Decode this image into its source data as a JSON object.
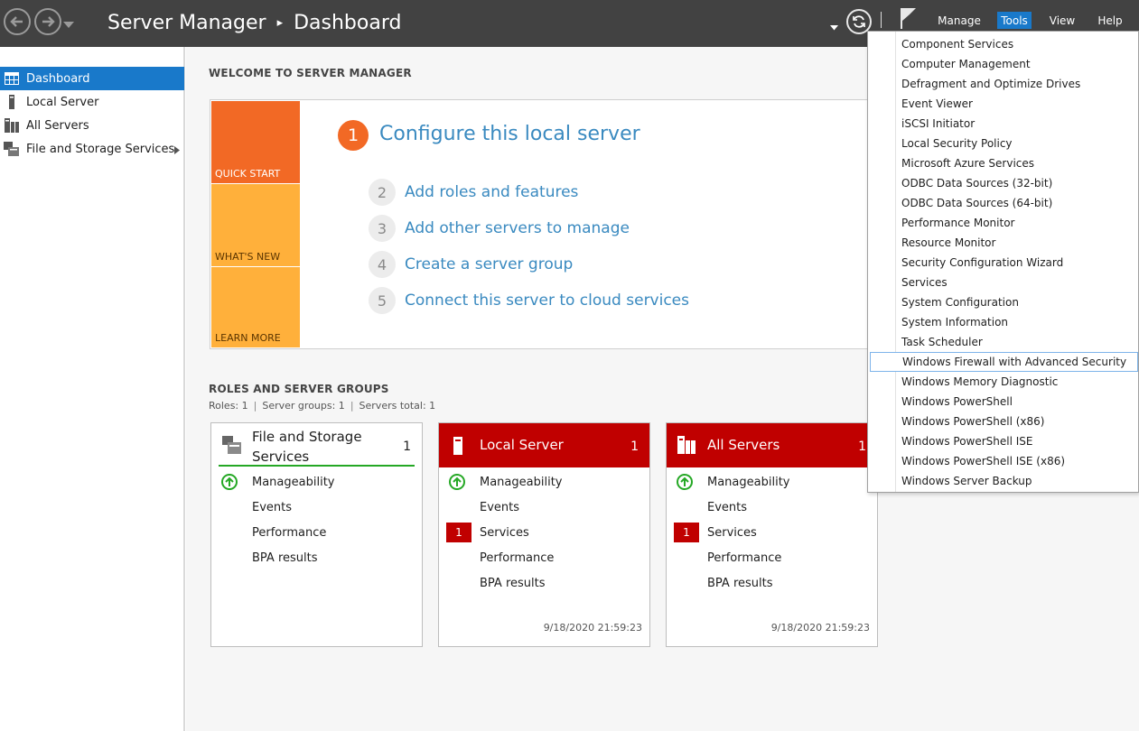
{
  "app": {
    "title": "Server Manager",
    "title_separator": "▸",
    "page": "Dashboard"
  },
  "titlebar": {
    "icons": [
      "back-arrow-icon",
      "forward-arrow-icon",
      "dropdown-icon",
      "refresh-icon",
      "notification-flag-icon"
    ],
    "menus": {
      "manage": "Manage",
      "tools": "Tools",
      "view": "View",
      "help": "Help"
    },
    "active_menu": "Tools"
  },
  "sidebar": {
    "items": [
      {
        "label": "Dashboard",
        "icon": "dashboard-grid-icon",
        "active": true
      },
      {
        "label": "Local Server",
        "icon": "server-icon",
        "active": false
      },
      {
        "label": "All Servers",
        "icon": "servers-icon",
        "active": false
      },
      {
        "label": "File and Storage Services",
        "icon": "storage-icon",
        "active": false,
        "has_submenu": true
      }
    ]
  },
  "welcome": {
    "heading": "WELCOME TO SERVER MANAGER",
    "tiles": {
      "quickstart": "QUICK START",
      "whatsnew": "WHAT'S NEW",
      "learnmore": "LEARN MORE"
    },
    "steps": [
      {
        "num": "1",
        "label": "Configure this local server"
      },
      {
        "num": "2",
        "label": "Add roles and features"
      },
      {
        "num": "3",
        "label": "Add other servers to manage"
      },
      {
        "num": "4",
        "label": "Create a server group"
      },
      {
        "num": "5",
        "label": "Connect this server to cloud services"
      }
    ]
  },
  "roles": {
    "heading": "ROLES AND SERVER GROUPS",
    "counts": {
      "roles": "Roles: 1",
      "groups": "Server groups: 1",
      "total": "Servers total: 1"
    },
    "cards": [
      {
        "title": "File and Storage Services",
        "count": "1",
        "rows": [
          "Manageability",
          "Events",
          "Performance",
          "BPA results"
        ],
        "timestamp": ""
      },
      {
        "title": "Local Server",
        "count": "1",
        "rows": [
          "Manageability",
          "Events",
          "Services",
          "Performance",
          "BPA results"
        ],
        "services_badge": "1",
        "timestamp": "9/18/2020 21:59:23"
      },
      {
        "title": "All Servers",
        "count": "1",
        "rows": [
          "Manageability",
          "Events",
          "Services",
          "Performance",
          "BPA results"
        ],
        "services_badge": "1",
        "timestamp": "9/18/2020 21:59:23"
      }
    ]
  },
  "tools_menu": {
    "items": [
      "Component Services",
      "Computer Management",
      "Defragment and Optimize Drives",
      "Event Viewer",
      "iSCSI Initiator",
      "Local Security Policy",
      "Microsoft Azure Services",
      "ODBC Data Sources (32-bit)",
      "ODBC Data Sources (64-bit)",
      "Performance Monitor",
      "Resource Monitor",
      "Security Configuration Wizard",
      "Services",
      "System Configuration",
      "System Information",
      "Task Scheduler",
      "Windows Firewall with Advanced Security",
      "Windows Memory Diagnostic",
      "Windows PowerShell",
      "Windows PowerShell (x86)",
      "Windows PowerShell ISE",
      "Windows PowerShell ISE (x86)",
      "Windows Server Backup"
    ],
    "hovered": "Windows Firewall with Advanced Security"
  },
  "colors": {
    "titlebar": "#424242",
    "accent_blue": "#1979ca",
    "quickstart_orange": "#f26925",
    "tile_yellow": "#ffb03b",
    "link_blue": "#3a8ac0",
    "alert_red": "#c00000",
    "ok_green": "#25a825"
  }
}
